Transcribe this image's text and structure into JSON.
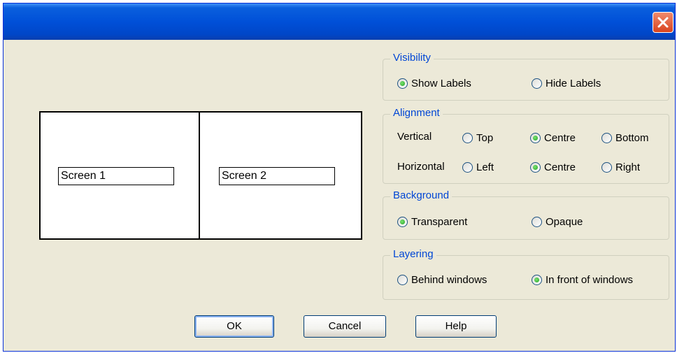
{
  "dialog": {
    "close_icon": "close-icon",
    "accent_color": "#0046d5"
  },
  "preview": {
    "screens": [
      {
        "label": "Screen 1"
      },
      {
        "label": "Screen 2"
      }
    ]
  },
  "visibility": {
    "title": "Visibility",
    "options": [
      {
        "label": "Show Labels",
        "selected": true
      },
      {
        "label": "Hide Labels",
        "selected": false
      }
    ]
  },
  "alignment": {
    "title": "Alignment",
    "vertical": {
      "label": "Vertical",
      "options": [
        {
          "label": "Top",
          "selected": false
        },
        {
          "label": "Centre",
          "selected": true
        },
        {
          "label": "Bottom",
          "selected": false
        }
      ]
    },
    "horizontal": {
      "label": "Horizontal",
      "options": [
        {
          "label": "Left",
          "selected": false
        },
        {
          "label": "Centre",
          "selected": true
        },
        {
          "label": "Right",
          "selected": false
        }
      ]
    }
  },
  "background": {
    "title": "Background",
    "options": [
      {
        "label": "Transparent",
        "selected": true
      },
      {
        "label": "Opaque",
        "selected": false
      }
    ]
  },
  "layering": {
    "title": "Layering",
    "options": [
      {
        "label": "Behind windows",
        "selected": false
      },
      {
        "label": "In front of windows",
        "selected": true
      }
    ]
  },
  "buttons": {
    "ok": "OK",
    "cancel": "Cancel",
    "help": "Help"
  }
}
